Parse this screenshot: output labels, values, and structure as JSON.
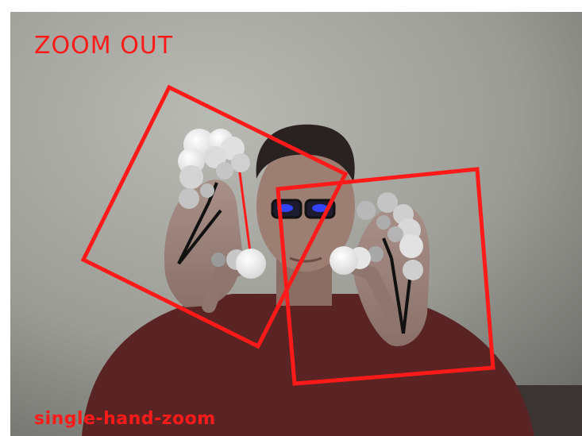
{
  "overlay": {
    "gesture_label": "ZOOM OUT",
    "mode_label": "single-hand-zoom"
  },
  "colors": {
    "overlay_red": "#ff1a1a",
    "wall": "#9e9e98",
    "sweater": "#5a2424",
    "landmark": "#eeeeee"
  }
}
